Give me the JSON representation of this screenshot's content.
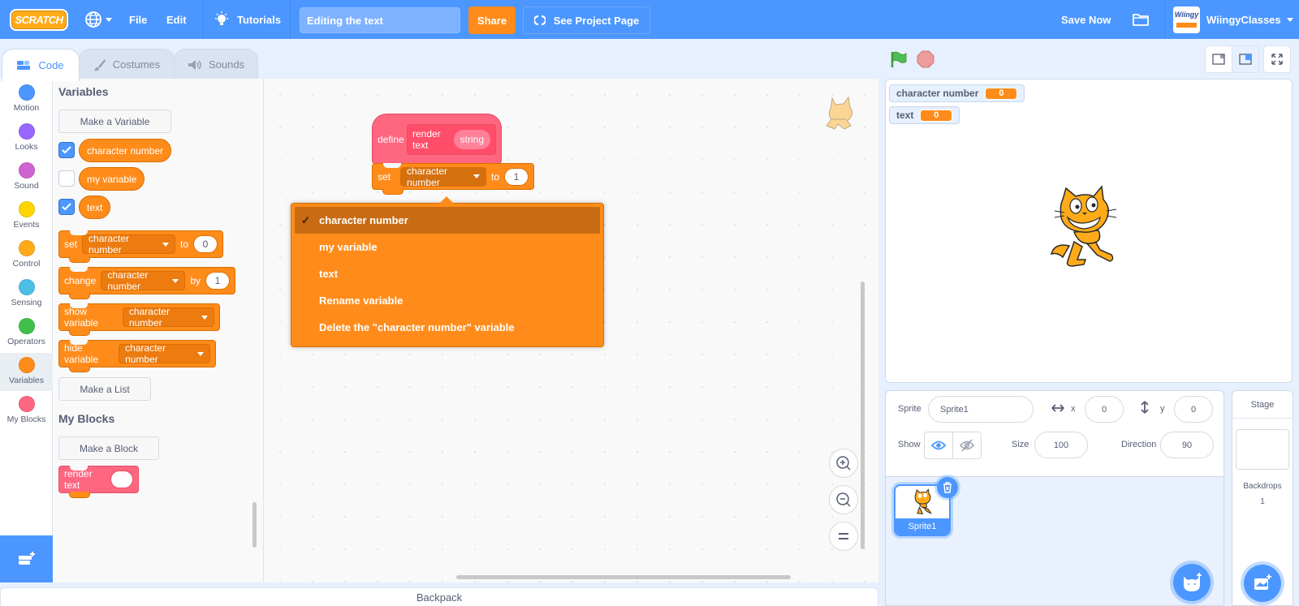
{
  "menubar": {
    "logo": "SCRATCH",
    "language_icon": "globe-icon",
    "file": "File",
    "edit": "Edit",
    "tutorials": "Tutorials",
    "project_title": "Editing the text",
    "share": "Share",
    "see_project_page": "See Project Page",
    "save_now": "Save Now",
    "username": "WiingyClasses",
    "avatar_text": "Wiingy"
  },
  "tabs": [
    {
      "label": "Code",
      "active": true
    },
    {
      "label": "Costumes",
      "active": false
    },
    {
      "label": "Sounds",
      "active": false
    }
  ],
  "categories": [
    {
      "label": "Motion",
      "color": "#4c97ff"
    },
    {
      "label": "Looks",
      "color": "#9966ff"
    },
    {
      "label": "Sound",
      "color": "#cf63cf"
    },
    {
      "label": "Events",
      "color": "#ffbf00"
    },
    {
      "label": "Control",
      "color": "#ffab19"
    },
    {
      "label": "Sensing",
      "color": "#5cb1d6"
    },
    {
      "label": "Operators",
      "color": "#59c059"
    },
    {
      "label": "Variables",
      "color": "#ff8c1a",
      "active": true
    },
    {
      "label": "My Blocks",
      "color": "#ff6680"
    }
  ],
  "palette": {
    "variables_heading": "Variables",
    "make_variable": "Make a Variable",
    "variables": [
      {
        "name": "character number",
        "checked": true
      },
      {
        "name": "my variable",
        "checked": false
      },
      {
        "name": "text",
        "checked": true
      }
    ],
    "blocks": {
      "set": {
        "label": "set",
        "var": "character number",
        "to": "to",
        "value": "0"
      },
      "change": {
        "label": "change",
        "var": "character number",
        "by": "by",
        "value": "1"
      },
      "show": {
        "label": "show variable",
        "var": "character number"
      },
      "hide": {
        "label": "hide variable",
        "var": "character number"
      }
    },
    "make_list": "Make a List",
    "my_blocks_heading": "My Blocks",
    "make_block": "Make a Block",
    "render_text": "render text"
  },
  "script": {
    "define": "define",
    "proc_name": "render text",
    "param": "string",
    "set_label": "set",
    "set_var": "character number",
    "to": "to",
    "set_value": "1"
  },
  "dropdown": {
    "items": [
      {
        "label": "character number",
        "selected": true
      },
      {
        "label": "my variable"
      },
      {
        "label": "text"
      },
      {
        "label": "Rename variable"
      },
      {
        "label": "Delete the \"character number\" variable"
      }
    ],
    "check": "✓"
  },
  "backpack": "Backpack",
  "stage": {
    "monitors": [
      {
        "label": "character number",
        "value": "0"
      },
      {
        "label": "text",
        "value": "0"
      }
    ]
  },
  "sprite_info": {
    "sprite_label": "Sprite",
    "sprite_name": "Sprite1",
    "x_label": "x",
    "x": "0",
    "y_label": "y",
    "y": "0",
    "show_label": "Show",
    "size_label": "Size",
    "size": "100",
    "direction_label": "Direction",
    "direction": "90"
  },
  "sprites": [
    {
      "name": "Sprite1",
      "selected": true
    }
  ],
  "stage_panel": {
    "title": "Stage",
    "backdrops_label": "Backdrops",
    "backdrops_count": "1"
  }
}
